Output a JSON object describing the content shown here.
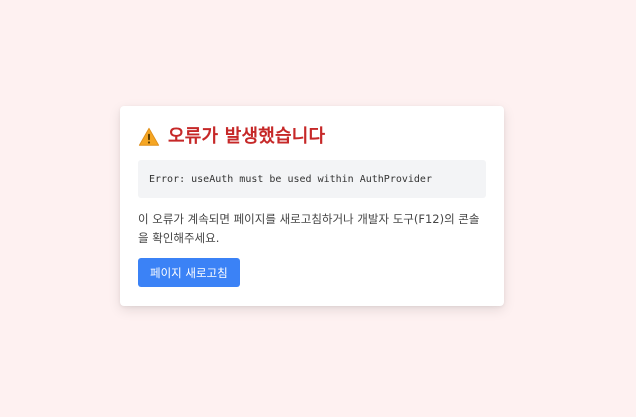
{
  "error_card": {
    "title": "오류가 발생했습니다",
    "icon": "warning-icon",
    "error_message": "Error: useAuth must be used within AuthProvider",
    "help_text": "이 오류가 계속되면 페이지를 새로고침하거나 개발자 도구(F12)의 콘솔을 확인해주세요.",
    "reload_button_label": "페이지 새로고침"
  },
  "colors": {
    "page_background": "#fef1f1",
    "title": "#c62828",
    "button": "#3b82f6",
    "code_background": "#f3f4f6"
  }
}
